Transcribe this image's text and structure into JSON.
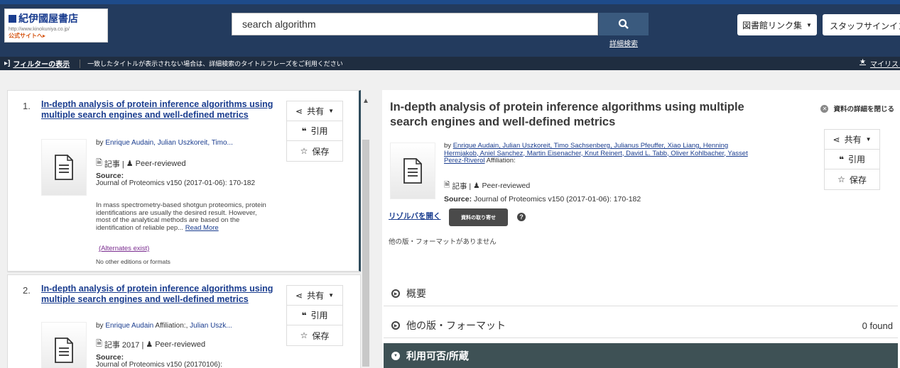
{
  "header": {
    "logo_name": "紀伊國屋書店",
    "logo_url": "http://www.kinokuniya.co.jp/",
    "logo_official": "公式サイトへ▸",
    "search_value": "search algorithm",
    "advanced_search": "詳細検索",
    "library_links": "図書館リンク集",
    "staff_signin": "スタッフサインイン"
  },
  "filterbar": {
    "show_filters": "フィルターの表示",
    "message": "一致したタイトルが表示されない場合は、詳細検索のタイトルフレーズをご利用ください",
    "my_list": "マイリスト"
  },
  "actions": {
    "share": "共有",
    "cite": "引用",
    "save": "保存"
  },
  "results": [
    {
      "num": "1.",
      "title": "In-depth analysis of protein inference algorithms using multiple search engines and well-defined metrics",
      "by_prefix": "by",
      "authors": "Enrique Audain, Julian Uszkoreit, Timo...",
      "type": "記事 | ",
      "peer": "Peer-reviewed",
      "source_label": "Source:",
      "source": "Journal of Proteomics v150 (2017-01-06): 170-182",
      "abstract": "In mass spectrometry-based shotgun proteomics, protein identifications are usually the desired result. However, most of the analytical methods are based on the identification of reliable pep...",
      "read_more": "Read More",
      "alternates": "(Alternates exist)",
      "other_editions": "No other editions or formats"
    },
    {
      "num": "2.",
      "title": "In-depth analysis of protein inference algorithms using multiple search engines and well-defined metrics",
      "by_prefix": "by",
      "authors": "Enrique Audain",
      "affil": " Affiliation:, ",
      "authors2": "Julian Uszk...",
      "type": "記事 2017 | ",
      "peer": "Peer-reviewed",
      "source_label": "Source:",
      "source": "Journal of Proteomics v150 (20170106):"
    }
  ],
  "detail": {
    "title": "In-depth analysis of protein inference algorithms using multiple search engines and well-defined metrics",
    "close": "資料の詳細を閉じる",
    "by_prefix": "by",
    "authors": "Enrique Audain, Julian Uszkoreit, Timo Sachsenberg, Julianus Pfeuffer, Xiao Liang, Henning Hermjakob, Aniel Sanchez, Martin Eisenacher, Knut Reinert, David L. Tabb, Oliver Kohlbacher, Yasset Perez-Riverol",
    "affiliation": " Affiliation:",
    "type": "記事 | ",
    "peer": "Peer-reviewed",
    "source_label": "Source:",
    "source": " Journal of Proteomics v150 (2017-01-06): 170-182",
    "link_resolver": "リゾルバを開く",
    "request_btn": "資料の取り寄せ",
    "no_other": "他の版・フォーマットがありません",
    "sections": [
      {
        "label": "概要",
        "count": ""
      },
      {
        "label": "他の版・フォーマット",
        "count": "0 found"
      },
      {
        "label": "利用可否/所蔵",
        "count": ""
      }
    ]
  },
  "colors": {
    "header_bg": "#233b5e",
    "filter_bg": "#1f2d40",
    "link": "#1a3d8f",
    "section_dark": "#3e5155"
  }
}
